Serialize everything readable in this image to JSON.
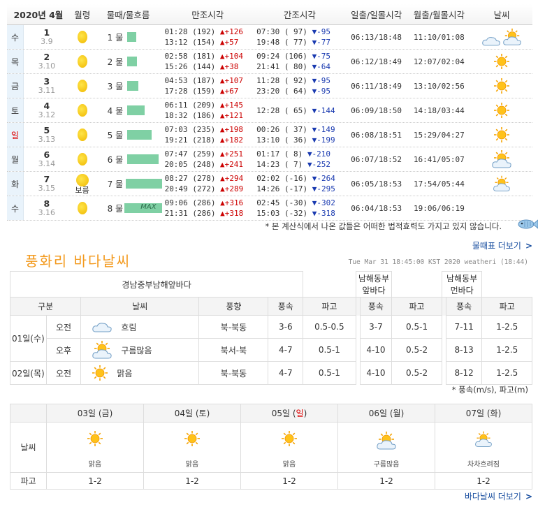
{
  "tide": {
    "headers": [
      "2020년  4월",
      "월령",
      "물때/물흐름",
      "만조시각",
      "간조시각",
      "일출/일몰시각",
      "월출/월몰시각",
      "날씨"
    ],
    "rows": [
      {
        "dow": "수",
        "day": "1",
        "lunar": "3.9",
        "mul": "1 물",
        "bar": 0.22,
        "max": "",
        "h1": "01:28 (192)",
        "d1": "▲+126",
        "h2": "13:12 (154)",
        "d2": "▲+57",
        "l1": "07:30 ( 97)",
        "e1": "▼-95",
        "l2": "19:48 ( 77)",
        "e2": "▼-77",
        "sun": "06:13/18:48",
        "moon": "11:10/01:08",
        "wx": "cloud-sun",
        "moontext": ""
      },
      {
        "dow": "목",
        "day": "2",
        "lunar": "3.10",
        "mul": "2 물",
        "bar": 0.24,
        "max": "",
        "h1": "02:58 (181)",
        "d1": "▲+104",
        "h2": "15:26 (144)",
        "d2": "▲+38",
        "l1": "09:24 (106)",
        "e1": "▼-75",
        "l2": "21:41 ( 80)",
        "e2": "▼-64",
        "sun": "06:12/18:49",
        "moon": "12:07/02:04",
        "wx": "sun",
        "moontext": ""
      },
      {
        "dow": "금",
        "day": "3",
        "lunar": "3.11",
        "mul": "3 물",
        "bar": 0.26,
        "max": "",
        "h1": "04:53 (187)",
        "d1": "▲+107",
        "h2": "17:28 (159)",
        "d2": "▲+67",
        "l1": "11:28 ( 92)",
        "e1": "▼-95",
        "l2": "23:20 ( 64)",
        "e2": "▼-95",
        "sun": "06:11/18:49",
        "moon": "13:10/02:56",
        "wx": "sun",
        "moontext": ""
      },
      {
        "dow": "토",
        "day": "4",
        "lunar": "3.12",
        "mul": "4 물",
        "bar": 0.42,
        "max": "",
        "h1": "06:11 (209)",
        "d1": "▲+145",
        "h2": "18:32 (186)",
        "d2": "▲+121",
        "l1": "12:28 ( 65)",
        "e1": "▼-144",
        "l2": "",
        "e2": "",
        "sun": "06:09/18:50",
        "moon": "14:18/03:44",
        "wx": "sun",
        "moontext": ""
      },
      {
        "dow": "일",
        "day": "5",
        "lunar": "3.13",
        "mul": "5 물",
        "bar": 0.58,
        "max": "",
        "h1": "07:03 (235)",
        "d1": "▲+198",
        "h2": "19:21 (218)",
        "d2": "▲+182",
        "l1": "00:26 ( 37)",
        "e1": "▼-149",
        "l2": "13:10 ( 36)",
        "e2": "▼-199",
        "sun": "06:08/18:51",
        "moon": "15:29/04:27",
        "wx": "sun",
        "moontext": ""
      },
      {
        "dow": "월",
        "day": "6",
        "lunar": "3.14",
        "mul": "6 물",
        "bar": 0.75,
        "max": "",
        "h1": "07:47 (259)",
        "d1": "▲+251",
        "h2": "20:05 (248)",
        "d2": "▲+241",
        "l1": "01:17 (  8)",
        "e1": "▼-210",
        "l2": "14:23 (  7)",
        "e2": "▼-252",
        "sun": "06:07/18:52",
        "moon": "16:41/05:07",
        "wx": "sun-cloud",
        "moontext": ""
      },
      {
        "dow": "화",
        "day": "7",
        "lunar": "3.15",
        "mul": "7 물",
        "bar": 0.92,
        "max": "",
        "h1": "08:27 (278)",
        "d1": "▲+294",
        "h2": "20:49 (272)",
        "d2": "▲+289",
        "l1": "02:02 (-16)",
        "e1": "▼-264",
        "l2": "14:26 (-17)",
        "e2": "▼-295",
        "sun": "06:05/18:53",
        "moon": "17:54/05:44",
        "wx": "sun-cloud-small",
        "moontext": "보름"
      },
      {
        "dow": "수",
        "day": "8",
        "lunar": "3.16",
        "mul": "8 물",
        "bar": 1.0,
        "max": "MAX",
        "h1": "09:06 (286)",
        "d1": "▲+316",
        "h2": "21:31 (286)",
        "d2": "▲+318",
        "l1": "02:45 (-30)",
        "e1": "▼-302",
        "l2": "15:03 (-32)",
        "e2": "▼-318",
        "sun": "06:04/18:53",
        "moon": "19:06/06:19",
        "wx": "",
        "moontext": ""
      }
    ],
    "disclaimer": "* 본 계산식에서 나온 값들은 어떠한 법적효력도 가지고 있지 않습니다.",
    "more_link": "물때표 더보기",
    "more_arrow": ">"
  },
  "sea": {
    "title": "풍화리 바다날씨",
    "stamp": "Tue Mar 31 18:45:00 KST 2020 weatheri (18:44)",
    "areas": [
      "경남중부남해앞바다",
      "남해동부앞바다",
      "남해동부먼바다"
    ],
    "sub_headers": [
      "구분",
      "날씨",
      "풍향",
      "풍속",
      "파고",
      "풍속",
      "파고",
      "풍속",
      "파고"
    ],
    "rows": [
      {
        "date": "01일(수)",
        "time": "오전",
        "wx_icon": "cloud",
        "wx": "흐림",
        "dir": "북-북동",
        "s1": "3-6",
        "w1": "0.5-0.5",
        "s2": "3-7",
        "w2": "0.5-1",
        "s3": "7-11",
        "w3": "1-2.5"
      },
      {
        "date": "",
        "time": "오후",
        "wx_icon": "sun-cloud",
        "wx": "구름많음",
        "dir": "북서-북",
        "s1": "4-7",
        "w1": "0.5-1",
        "s2": "4-10",
        "w2": "0.5-2",
        "s3": "8-13",
        "w3": "1-2.5"
      },
      {
        "date": "02일(목)",
        "time": "오전",
        "wx_icon": "sun",
        "wx": "맑음",
        "dir": "북-북동",
        "s1": "4-7",
        "w1": "0.5-1",
        "s2": "4-10",
        "w2": "0.5-2",
        "s3": "8-12",
        "w3": "1-2.5"
      }
    ],
    "unit_note": "* 풍속(m/s), 파고(m)"
  },
  "week": {
    "row_labels": {
      "weather": "날씨",
      "wave": "파고"
    },
    "days": [
      {
        "pre": "03일 (",
        "dow": "금",
        "post": ")",
        "red": false,
        "icon": "sun",
        "wx": "맑음",
        "wave": "1-2"
      },
      {
        "pre": "04일 (",
        "dow": "토",
        "post": ")",
        "red": false,
        "icon": "sun",
        "wx": "맑음",
        "wave": "1-2"
      },
      {
        "pre": "05일 (",
        "dow": "일",
        "post": ")",
        "red": true,
        "icon": "sun",
        "wx": "맑음",
        "wave": "1-2"
      },
      {
        "pre": "06일 (",
        "dow": "월",
        "post": ")",
        "red": false,
        "icon": "sun-cloud",
        "wx": "구름많음",
        "wave": "1-2"
      },
      {
        "pre": "07일 (",
        "dow": "화",
        "post": ")",
        "red": false,
        "icon": "sun-cloud-small",
        "wx": "차차흐려짐",
        "wave": "1-2"
      }
    ],
    "more_link": "바다날씨 더보기",
    "more_arrow": ">"
  },
  "colors": {
    "accent_orange": "#f39a1e",
    "link_blue": "#1a4fa0",
    "up_red": "#cc0000",
    "down_blue": "#1a3ab0",
    "bar_green": "#7fd0a4"
  }
}
